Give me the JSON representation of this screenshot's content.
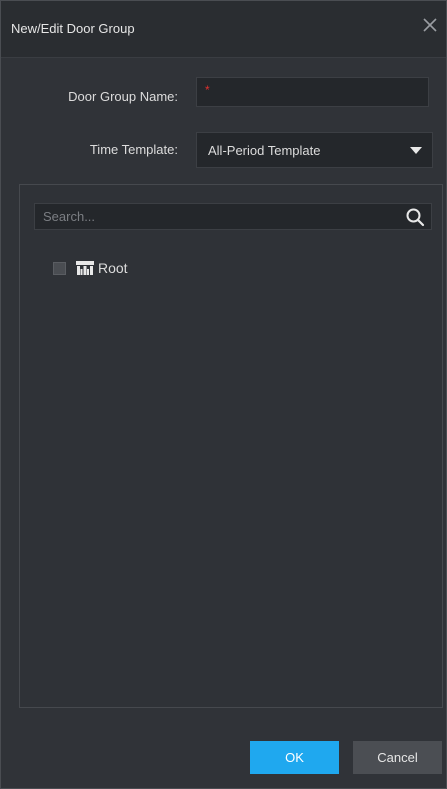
{
  "dialog": {
    "title": "New/Edit Door Group",
    "close_icon": "close-icon"
  },
  "form": {
    "name_label": "Door Group Name:",
    "name_value": "",
    "name_required_marker": "*",
    "template_label": "Time Template:",
    "template_value": "All-Period Template"
  },
  "tree": {
    "search_placeholder": "Search...",
    "search_icon": "search-icon",
    "nodes": [
      {
        "label": "Root",
        "icon": "door-group-icon",
        "checked": false
      }
    ]
  },
  "buttons": {
    "ok_label": "OK",
    "cancel_label": "Cancel"
  },
  "colors": {
    "accent": "#1fa8ef",
    "required": "#e0312f"
  }
}
